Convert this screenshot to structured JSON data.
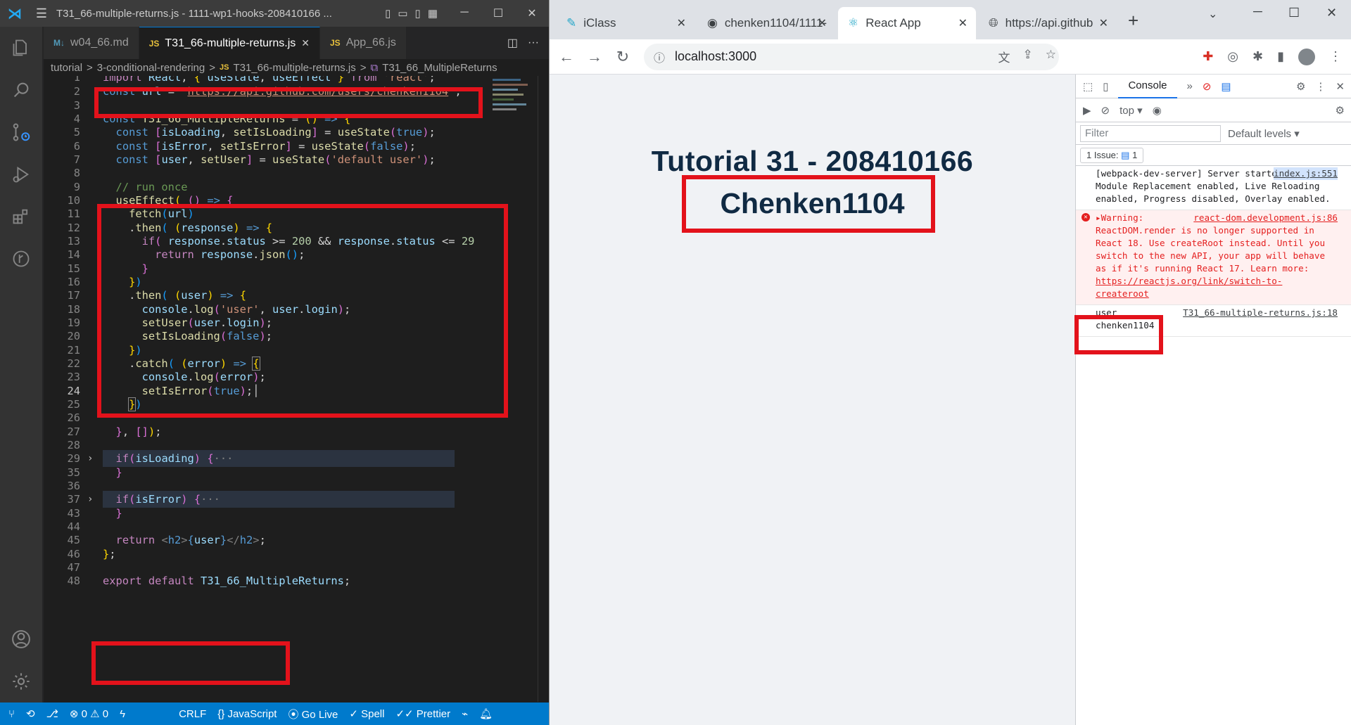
{
  "vscode": {
    "title": "T31_66-multiple-returns.js - 1111-wp1-hooks-208410166 ...",
    "tabs": [
      {
        "label": "w04_66.md",
        "badge": "M↓"
      },
      {
        "label": "T31_66-multiple-returns.js",
        "badge": "JS"
      },
      {
        "label": "App_66.js",
        "badge": "JS"
      }
    ],
    "breadcrumb": [
      "tutorial",
      ">",
      "3-conditional-rendering",
      ">",
      "T31_66-multiple-returns.js",
      ">",
      "T31_66_MultipleReturns"
    ],
    "line_numbers": [
      "1",
      "2",
      "3",
      "4",
      "5",
      "6",
      "7",
      "8",
      "9",
      "10",
      "11",
      "12",
      "13",
      "14",
      "15",
      "16",
      "17",
      "18",
      "19",
      "20",
      "21",
      "22",
      "23",
      "24",
      "25",
      "26",
      "27",
      "28",
      "29",
      "35",
      "36",
      "37",
      "43",
      "44",
      "45",
      "46",
      "47",
      "48"
    ],
    "status": {
      "crlf": "CRLF",
      "lang": "JavaScript",
      "golive": "Go Live",
      "spell": "Spell",
      "prettier": "Prettier",
      "errors": "0",
      "warnings": "0"
    }
  },
  "browser": {
    "tabs": [
      "iClass",
      "chenken1104/1111-",
      "React App",
      "https://api.github"
    ],
    "url": "localhost:3000",
    "heading": "Tutorial 31 - 208410166",
    "user": "Chenken1104",
    "devtools": {
      "tab": "Console",
      "context": "top",
      "filter_placeholder": "Filter",
      "levels": "Default levels",
      "issues": "1 Issue:",
      "issue_count": "1",
      "msg1": "[webpack-dev-server] Server started: Hot Module Replacement enabled, Live Reloading enabled, Progress disabled, Overlay enabled.",
      "msg1_src": "index.js:551",
      "warn_label": "▸Warning:",
      "warn_src": "react-dom.development.js:86",
      "warn_text": "ReactDOM.render is no longer supported in React 18. Use createRoot instead. Until you switch to the new API, your app will behave as if it's running React 17. Learn more: ",
      "warn_link": "https://reactjs.org/link/switch-to-createroot",
      "log_label": "user",
      "log_src": "T31_66-multiple-returns.js:18",
      "log_value": "chenken1104"
    }
  }
}
